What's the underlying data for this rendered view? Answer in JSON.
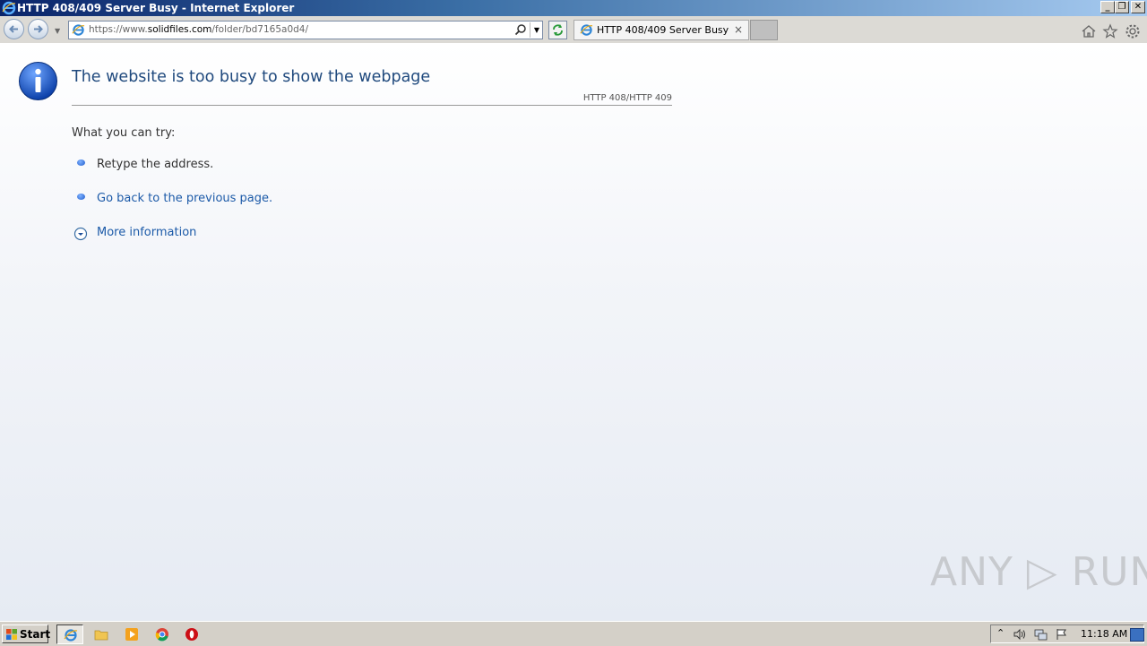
{
  "window": {
    "title": "HTTP 408/409 Server Busy - Internet Explorer",
    "minimize_label": "_",
    "restore_label": "❐",
    "close_label": "✕"
  },
  "navbar": {
    "url_prefix": "https://www.",
    "url_domain": "solidfiles.com",
    "url_path": "/folder/bd7165a0d4/",
    "tab_label": "HTTP 408/409 Server Busy",
    "tab_close": "×"
  },
  "page": {
    "heading": "The website is too busy to show the webpage",
    "http_code": "HTTP 408/HTTP 409",
    "try_label": "What you can try:",
    "retype": "Retype the address.",
    "go_back": "Go back to the previous page.",
    "more_info": "More information"
  },
  "watermark": "ANY ▷ RUN",
  "taskbar": {
    "start_label": "Start",
    "clock": "11:18 AM"
  },
  "colors": {
    "heading": "#1f497d",
    "link": "#1c5aa8"
  }
}
